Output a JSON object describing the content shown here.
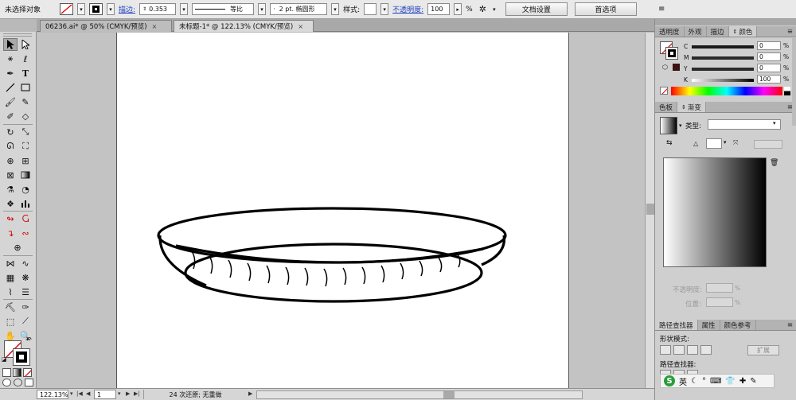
{
  "control_bar": {
    "selection_status": "未选择对象",
    "stroke_label": "描边:",
    "stroke_weight": "0.353",
    "stroke_profile": "等比",
    "brush": "2 pt. 椭圆形",
    "style_label": "样式:",
    "opacity_label": "不透明度:",
    "opacity_value": "100",
    "opacity_unit": "%",
    "doc_setup_button": "文档设置",
    "preferences_button": "首选项"
  },
  "tabs": [
    {
      "label": "06236.ai* @ 50% (CMYK/预览)",
      "close": "×"
    },
    {
      "label": "未标题-1* @ 122.13% (CMYK/预览)",
      "close": "×"
    }
  ],
  "status_bar": {
    "zoom": "122.13%",
    "artboard_number": "1",
    "undo_info": "24 次还原; 无重做"
  },
  "color_panel": {
    "tabs": [
      "透明度",
      "外观",
      "描边",
      "颜色"
    ],
    "channels": [
      {
        "name": "C",
        "value": "0"
      },
      {
        "name": "M",
        "value": "0"
      },
      {
        "name": "Y",
        "value": "0"
      },
      {
        "name": "K",
        "value": "100"
      }
    ],
    "percent": "%"
  },
  "gradient_panel": {
    "tabs": [
      "色板",
      "渐变"
    ],
    "type_label": "类型:",
    "opacity_label": "不透明度:",
    "location_label": "位置:",
    "percent": "%"
  },
  "bottom_panel": {
    "tabs": [
      "路径查找器",
      "属性",
      "颜色参考"
    ],
    "shape_mode_label": "形状模式:",
    "pathfinder_label": "路径查找器:",
    "expand_button": "扩展"
  },
  "ime": {
    "lang": "英"
  },
  "colors": {
    "toolbar_bg": "#e9e9e9",
    "panel_bg": "#cfcfcf",
    "canvas_bg": "#c3c3c3",
    "link_blue": "#1f3fbf"
  }
}
